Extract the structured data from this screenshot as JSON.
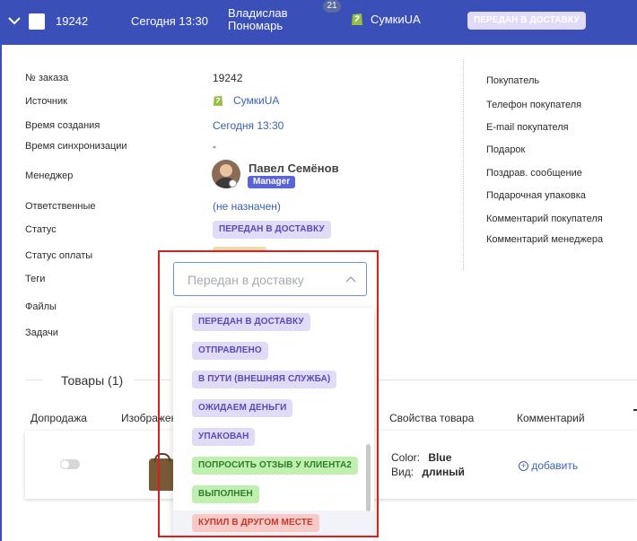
{
  "header": {
    "order_number": "19242",
    "created": "Сегодня 13:30",
    "customer_line1": "Владислав",
    "customer_line2": "Пономарь",
    "notification_count": "21",
    "shop_name": "СумкиUA",
    "status": "ПЕРЕДАН В ДОСТАВКУ"
  },
  "details": {
    "labels": {
      "order_no": "№ заказа",
      "source": "Источник",
      "created": "Время создания",
      "sync": "Время синхронизации",
      "manager": "Менеджер",
      "responsible": "Ответственные",
      "status": "Статус",
      "payment_status": "Статус оплаты",
      "tags": "Теги",
      "files": "Файлы",
      "tasks": "Задачи"
    },
    "values": {
      "order_no": "19242",
      "source": "СумкиUA",
      "created": "Сегодня 13:30",
      "sync": "-",
      "manager_name": "Павел Семёнов",
      "manager_role": "Manager",
      "responsible": "(не назначен)",
      "status": "ПЕРЕДАН В ДОСТАВКУ"
    }
  },
  "buyer": {
    "labels": [
      "Покупатель",
      "Телефон покупателя",
      "E-mail покупателя",
      "Подарок",
      "Поздрав. сообщение",
      "Подарочная упаковка",
      "Комментарий покупателя",
      "Комментарий менеджера"
    ]
  },
  "status_dropdown": {
    "selected_placeholder": "Передан в доставку",
    "options": [
      {
        "label": "ПЕРЕДАН В ДОСТАВКУ",
        "color": "purple"
      },
      {
        "label": "ОТПРАВЛЕНО",
        "color": "purple"
      },
      {
        "label": "В ПУТИ (ВНЕШНЯЯ СЛУЖБА)",
        "color": "purple"
      },
      {
        "label": "ОЖИДАЕМ ДЕНЬГИ",
        "color": "purple"
      },
      {
        "label": "УПАКОВАН",
        "color": "purple"
      },
      {
        "label": "ПОПРОСИТЬ ОТЗЫВ У КЛИЕНТА2",
        "color": "green"
      },
      {
        "label": "ВЫПОЛНЕН",
        "color": "green"
      },
      {
        "label": "КУПИЛ В ДРУГОМ МЕСТЕ",
        "color": "red"
      }
    ]
  },
  "products": {
    "section_title": "Товары (1)",
    "columns": {
      "upsell": "Допродажа",
      "image": "Изображен",
      "properties": "Свойства товара",
      "comment": "Комментарий"
    },
    "row": {
      "prop1_label": "Color:",
      "prop1_value": "Blue",
      "prop2_label": "Вид:",
      "prop2_value": "длиный",
      "add_comment": "добавить"
    }
  },
  "colors": {
    "header_bg": "#3b4fb8",
    "link": "#3a5fb5",
    "highlight_frame": "#e01b1b"
  }
}
